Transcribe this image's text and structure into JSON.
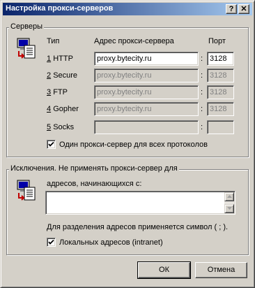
{
  "window": {
    "title": "Настройка прокси-серверов",
    "help_button": "?",
    "close_button": "✕"
  },
  "servers": {
    "group_label": "Серверы",
    "col_type": "Тип",
    "col_address": "Адрес прокси-сервера",
    "col_port": "Порт",
    "separator": ":",
    "rows": [
      {
        "num": "1",
        "label": "HTTP",
        "address": "proxy.bytecity.ru",
        "port": "3128",
        "enabled": true
      },
      {
        "num": "2",
        "label": "Secure",
        "address": "proxy.bytecity.ru",
        "port": "3128",
        "enabled": false
      },
      {
        "num": "3",
        "label": "FTP",
        "address": "proxy.bytecity.ru",
        "port": "3128",
        "enabled": false
      },
      {
        "num": "4",
        "label": "Gopher",
        "address": "proxy.bytecity.ru",
        "port": "3128",
        "enabled": false
      },
      {
        "num": "5",
        "label": "Socks",
        "address": "",
        "port": "",
        "enabled": false
      }
    ],
    "same_proxy": {
      "label": "Один прокси-сервер для всех протоколов",
      "checked": true
    }
  },
  "exceptions": {
    "group_label": "Исключения. Не применять прокси-сервер для",
    "prompt": "адресов, начинающихся с:",
    "value": "",
    "hint": "Для разделения адресов применяется символ ( ; ).",
    "local": {
      "label": "Локальных адресов (intranet)",
      "checked": true
    }
  },
  "buttons": {
    "ok": "ОК",
    "cancel": "Отмена"
  },
  "colors": {
    "face": "#d4d0c8",
    "title_start": "#0a246a",
    "title_end": "#a6caf0",
    "disabled_text": "#808080"
  }
}
